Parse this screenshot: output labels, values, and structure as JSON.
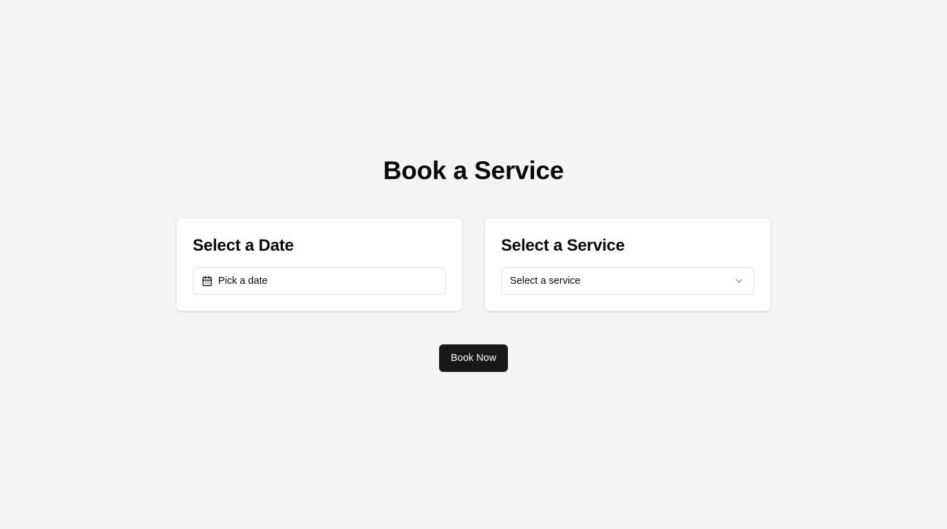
{
  "page": {
    "title": "Book a Service"
  },
  "date_card": {
    "title": "Select a Date",
    "picker_label": "Pick a date",
    "icon": "calendar-icon"
  },
  "service_card": {
    "title": "Select a Service",
    "select_placeholder": "Select a service",
    "icon": "chevron-down-icon"
  },
  "actions": {
    "book_label": "Book Now"
  },
  "colors": {
    "background": "#f3f4f6",
    "card": "#ffffff",
    "primary_button": "#18181b",
    "primary_button_text": "#fafafa",
    "text": "#09090b",
    "border": "#e4e4e7"
  }
}
